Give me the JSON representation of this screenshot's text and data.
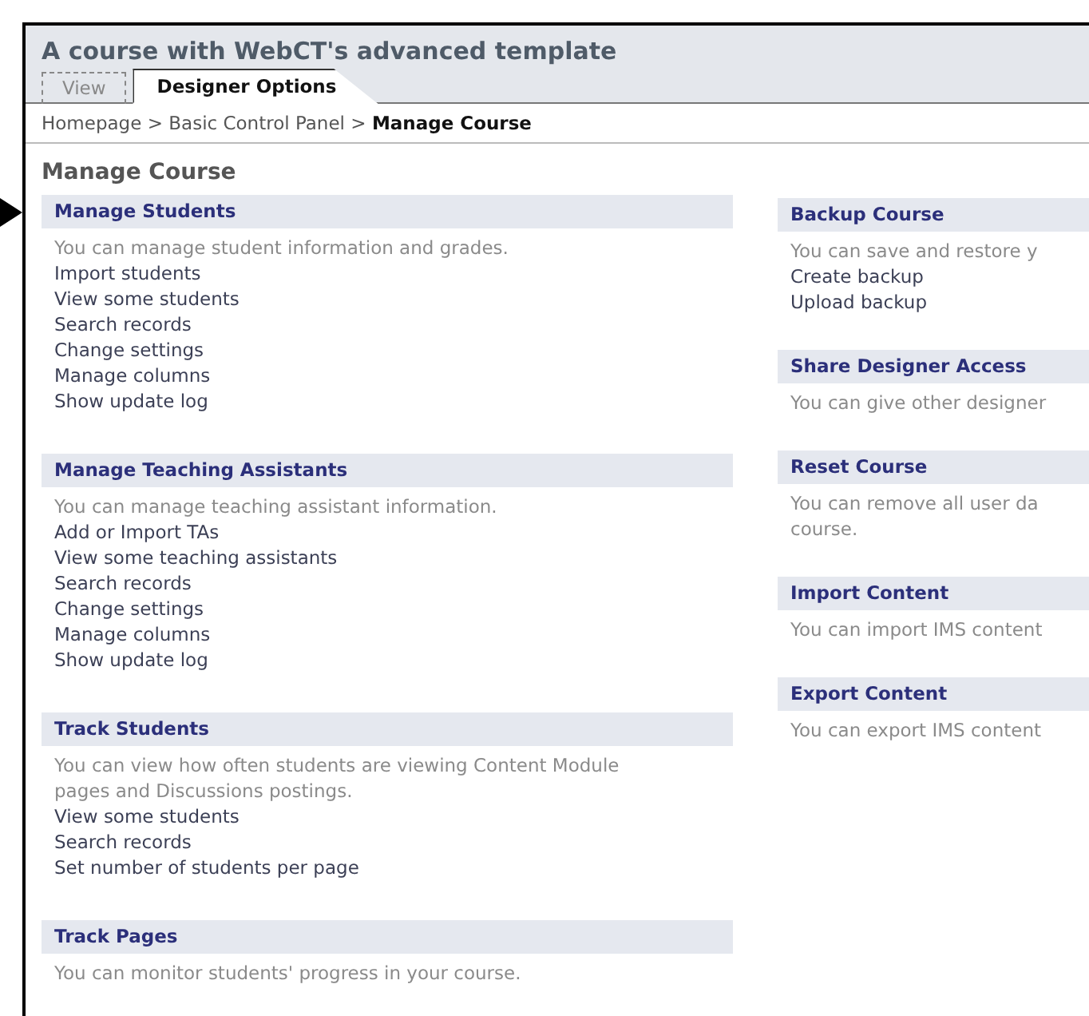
{
  "window": {
    "title": "A course with WebCT's advanced template"
  },
  "tabs": [
    {
      "label": "View",
      "selected": false
    },
    {
      "label": "Designer Options",
      "selected": true
    }
  ],
  "breadcrumb": [
    {
      "label": "Homepage",
      "current": false
    },
    {
      "label": "Basic Control Panel",
      "current": false
    },
    {
      "label": "Manage Course",
      "current": true
    }
  ],
  "breadcrumb_separator": ">",
  "page_heading": "Manage Course",
  "left_sections": [
    {
      "title": "Manage Students",
      "pointed": true,
      "description": [
        "You can manage student information and grades."
      ],
      "links": [
        "Import students",
        "View some students",
        "Search records",
        "Change settings",
        "Manage columns",
        "Show update log"
      ]
    },
    {
      "title": "Manage Teaching Assistants",
      "description": [
        "You can manage teaching assistant information."
      ],
      "links": [
        "Add or Import TAs",
        "View some teaching assistants",
        "Search records",
        "Change settings",
        "Manage columns",
        "Show update log"
      ]
    },
    {
      "title": "Track Students",
      "description": [
        "You can view how often students are viewing Content Module",
        "pages and Discussions postings."
      ],
      "links": [
        "View some students",
        "Search records",
        "Set number of students per page"
      ]
    },
    {
      "title": "Track Pages",
      "description": [
        "You can monitor students' progress in your course."
      ]
    }
  ],
  "right_sections": [
    {
      "title": "Backup Course",
      "description": [
        "You can save and restore y"
      ],
      "links": [
        "Create backup",
        "Upload backup"
      ]
    },
    {
      "title": "Share Designer Access",
      "description": [
        "You can give other designer"
      ]
    },
    {
      "title": "Reset Course",
      "description": [
        "You can remove all user da",
        "course."
      ]
    },
    {
      "title": "Import Content",
      "description": [
        "You can import IMS content"
      ]
    },
    {
      "title": "Export Content",
      "description": [
        "You can export IMS content"
      ]
    }
  ]
}
